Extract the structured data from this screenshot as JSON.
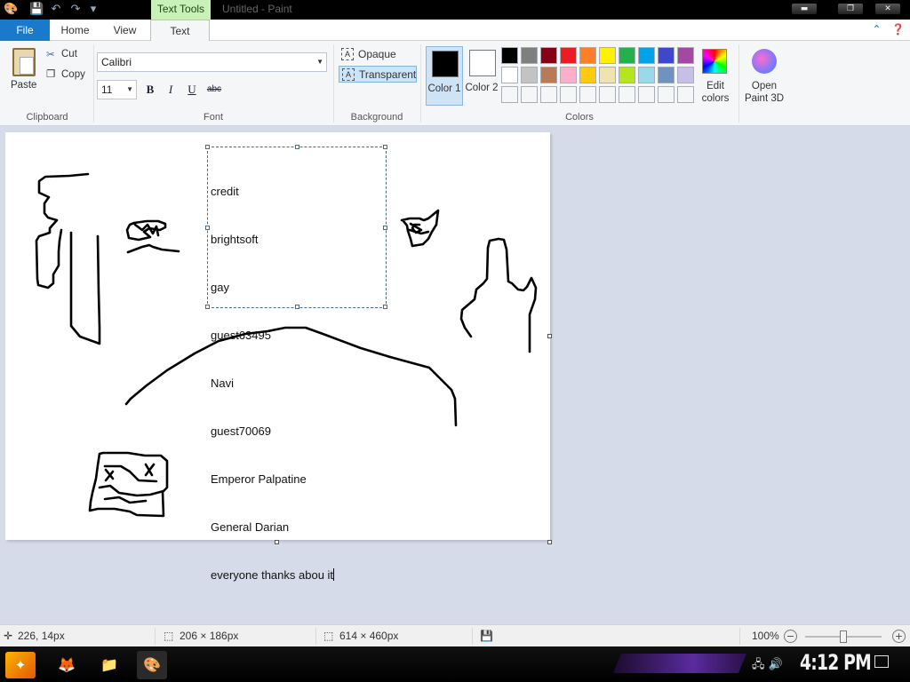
{
  "titlebar": {
    "context_tab": "Text Tools",
    "title": "Untitled - Paint",
    "controls": {
      "minimize": "▬",
      "maximize": "❐",
      "close": "✕"
    }
  },
  "tabs": {
    "file": "File",
    "home": "Home",
    "view": "View",
    "text": "Text"
  },
  "ribbon": {
    "clipboard": {
      "paste": "Paste",
      "cut": "Cut",
      "copy": "Copy",
      "label": "Clipboard"
    },
    "font": {
      "family": "Calibri",
      "size": "11",
      "bold": "B",
      "italic": "I",
      "underline": "U",
      "strike": "abc",
      "label": "Font"
    },
    "background": {
      "opaque": "Opaque",
      "transparent": "Transparent",
      "label": "Background"
    },
    "colors": {
      "color1_label": "Color 1",
      "color2_label": "Color 2",
      "color1_value": "#000000",
      "color2_value": "#ffffff",
      "edit_colors": "Edit colors",
      "label": "Colors",
      "palette_row1": [
        "#000000",
        "#7f7f7f",
        "#880015",
        "#ed1c24",
        "#ff7f27",
        "#fff200",
        "#22b14c",
        "#00a2e8",
        "#3f48cc",
        "#a349a4"
      ],
      "palette_row2": [
        "#ffffff",
        "#c3c3c3",
        "#b97a57",
        "#ffaec9",
        "#ffc90e",
        "#efe4b0",
        "#b5e61d",
        "#99d9ea",
        "#7092be",
        "#c8bfe7"
      ],
      "palette_row3": [
        "#f5f6f7",
        "#f5f6f7",
        "#f5f6f7",
        "#f5f6f7",
        "#f5f6f7",
        "#f5f6f7",
        "#f5f6f7",
        "#f5f6f7",
        "#f5f6f7",
        "#f5f6f7"
      ]
    },
    "paint3d": "Open Paint 3D"
  },
  "canvas": {
    "text_lines": [
      "credit",
      "brightsoft",
      "gay",
      "guest63495",
      "Navi",
      "guest70069",
      "Emperor Palpatine",
      "General Darian",
      "everyone thanks abou it"
    ]
  },
  "status": {
    "cursor_pos": "226, 14px",
    "selection_size": "206 × 186px",
    "canvas_size": "614 × 460px",
    "zoom": "100%"
  },
  "taskbar": {
    "clock": "4:12 PM"
  }
}
